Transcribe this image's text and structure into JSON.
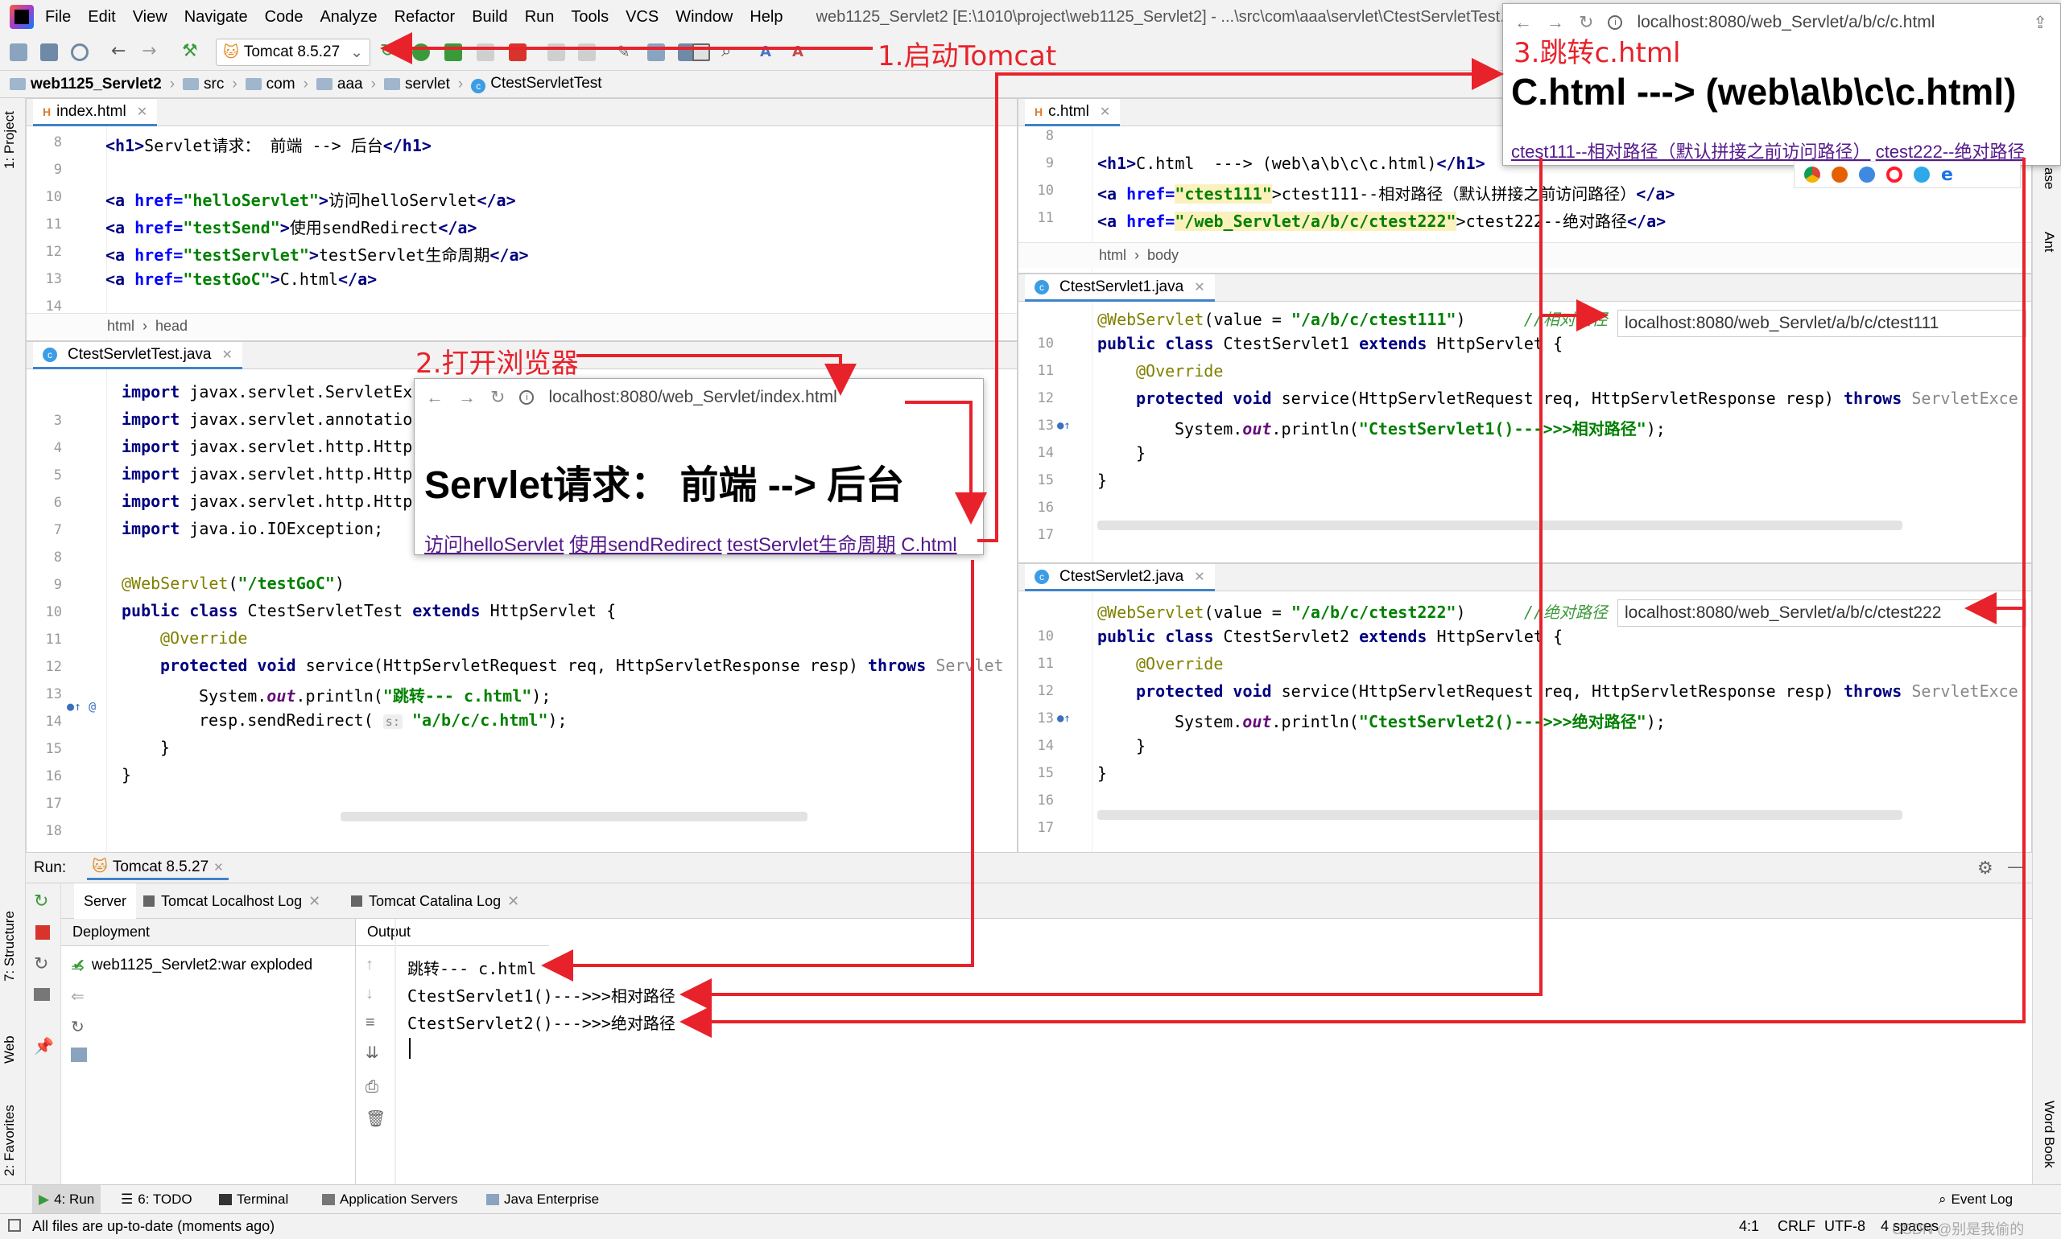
{
  "window": {
    "title": "web1125_Servlet2 [E:\\1010\\project\\web1125_Servlet2] - ...\\src\\com\\aaa\\servlet\\CtestServletTest.java - Int"
  },
  "menu": [
    "File",
    "Edit",
    "View",
    "Navigate",
    "Code",
    "Analyze",
    "Refactor",
    "Build",
    "Run",
    "Tools",
    "VCS",
    "Window",
    "Help"
  ],
  "toolbar": {
    "run_config": "Tomcat 8.5.27"
  },
  "breadcrumb": [
    "web1125_Servlet2",
    "src",
    "com",
    "aaa",
    "servlet",
    "CtestServletTest"
  ],
  "side_tabs": {
    "left": [
      "1: Project",
      "7: Structure",
      "Web",
      "2: Favorites"
    ],
    "right": [
      "ase",
      "Ant",
      "Word Book"
    ]
  },
  "editor_index": {
    "tab": "index.html",
    "lines": [
      {
        "n": "8"
      },
      {
        "n": "9"
      },
      {
        "n": "10"
      },
      {
        "n": "11"
      },
      {
        "n": "12"
      },
      {
        "n": "13"
      },
      {
        "n": "14"
      }
    ],
    "code": [
      {
        "h1_open": "<h1>",
        "text": "Servlet请求： 前端 --> 后台",
        "h1_close": "</h1>"
      },
      {
        "a_open": "<a ",
        "href": "href=",
        "val": "\"helloServlet\"",
        "gt": ">",
        "text": "访问helloServlet",
        "close": "</a>"
      },
      {
        "a_open": "<a ",
        "href": "href=",
        "val": "\"testSend\"",
        "gt": ">",
        "text": "使用sendRedirect",
        "close": "</a>"
      },
      {
        "a_open": "<a ",
        "href": "href=",
        "val": "\"testServlet\"",
        "gt": ">",
        "text": "testServlet生命周期",
        "close": "</a>"
      },
      {
        "a_open": "<a ",
        "href": "href=",
        "val": "\"testGoC\"",
        "gt": ">",
        "text": "C.html",
        "close": "</a>"
      }
    ],
    "crumbs": [
      "html",
      "head"
    ]
  },
  "editor_test": {
    "tab": "CtestServletTest.java",
    "line_numbers": [
      "3",
      "4",
      "5",
      "6",
      "7",
      "8",
      "9",
      "10",
      "11",
      "12",
      "13",
      "14",
      "15",
      "16",
      "17",
      "18"
    ],
    "imports": [
      "javax.servlet.ServletEx",
      "javax.servlet.annotatio",
      "javax.servlet.http.Http",
      "javax.servlet.http.Http",
      "javax.servlet.http.Http",
      "java.io.IOException;"
    ],
    "import_kw": "import",
    "annotation": "@WebServlet",
    "annotation_arg": "\"/testGoC\"",
    "class_decl": {
      "kw1": "public class",
      "name": "CtestServletTest",
      "kw2": "extends",
      "parent": "HttpServlet {"
    },
    "override": "@Override",
    "method": {
      "kw": "protected void",
      "sig": "service(HttpServletRequest req, HttpServletResponse resp)",
      "throws": "throws",
      "rest": "Servlet"
    },
    "println": {
      "pre": "System.",
      "out": "out",
      "mid": ".println(",
      "str": "\"跳转--- c.html\"",
      "end": ");"
    },
    "redirect": {
      "pre": "resp.sendRedirect(",
      "hint": "s:",
      "str": "\"a/b/c/c.html\"",
      "end": ");"
    },
    "close1": "}",
    "close2": "}"
  },
  "editor_c": {
    "tab": "c.html",
    "line_numbers": [
      "8",
      "9",
      "10",
      "11"
    ],
    "l9": {
      "open": "<h1>",
      "text": "C.html  ---> (web\\a\\b\\c\\c.html)",
      "close": "</h1>"
    },
    "l10": {
      "a": "<a ",
      "href": "href=",
      "val": "\"ctest111\"",
      "text": ">ctest111--相对路径（默认拼接之前访问路径）",
      "close": "</a>"
    },
    "l11": {
      "a": "<a ",
      "href": "href=",
      "val": "\"/web_Servlet/a/b/c/ctest222\"",
      "text": ">ctest222--绝对路径",
      "close": "</a>"
    },
    "crumbs": [
      "html",
      "body"
    ]
  },
  "editor_s1": {
    "tab": "CtestServlet1.java",
    "line_numbers": [
      "10",
      "11",
      "12",
      "13",
      "14",
      "15",
      "16",
      "17"
    ],
    "anno": "@WebServlet",
    "anno_args": "(value = ",
    "anno_str": "\"/a/b/c/ctest111\"",
    "anno_end": ")",
    "comment": "//相对路径",
    "decl": {
      "kw1": "public class",
      "name": "CtestServlet1",
      "kw2": "extends",
      "parent": "HttpServlet {"
    },
    "override": "@Override",
    "method": {
      "kw": "protected void",
      "sig": "service(HttpServletRequest req, HttpServletResponse resp)",
      "throws": "throws",
      "rest": "ServletExce"
    },
    "println": {
      "pre": "System.",
      "out": "out",
      "mid": ".println(",
      "str": "\"CtestServlet1()--->>>相对路径\"",
      "end": ");"
    },
    "close1": "}",
    "close2": "}",
    "tip": "localhost:8080/web_Servlet/a/b/c/ctest111"
  },
  "editor_s2": {
    "tab": "CtestServlet2.java",
    "line_numbers": [
      "10",
      "11",
      "12",
      "13",
      "14",
      "15",
      "16",
      "17"
    ],
    "anno": "@WebServlet",
    "anno_args": "(value = ",
    "anno_str": "\"/a/b/c/ctest222\"",
    "anno_end": ")",
    "comment": "//绝对路径",
    "decl": {
      "kw1": "public class",
      "name": "CtestServlet2",
      "kw2": "extends",
      "parent": "HttpServlet {"
    },
    "override": "@Override",
    "method": {
      "kw": "protected void",
      "sig": "service(HttpServletRequest req, HttpServletResponse resp)",
      "throws": "throws",
      "rest": "ServletExce"
    },
    "println": {
      "pre": "System.",
      "out": "out",
      "mid": ".println(",
      "str": "\"CtestServlet2()--->>>绝对路径\"",
      "end": ");"
    },
    "close1": "}",
    "close2": "}",
    "tip": "localhost:8080/web_Servlet/a/b/c/ctest222"
  },
  "browser1": {
    "url": "localhost:8080/web_Servlet/index.html",
    "heading": "Servlet请求： 前端 --> 后台",
    "links": [
      "访问helloServlet",
      "使用sendRedirect",
      "testServlet生命周期",
      "C.html"
    ]
  },
  "browser2": {
    "url": "localhost:8080/web_Servlet/a/b/c/c.html",
    "heading": "C.html ---> (web\\a\\b\\c\\c.html)",
    "links": [
      "ctest111--相对路径（默认拼接之前访问路径）",
      "ctest222--绝对路径"
    ]
  },
  "annotations": {
    "n1": "1.启动Tomcat",
    "n2": "2.打开浏览器",
    "n3": "3.跳转c.html"
  },
  "run": {
    "label": "Run:",
    "config": "Tomcat 8.5.27",
    "tabs": [
      "Server",
      "Tomcat Localhost Log",
      "Tomcat Catalina Log"
    ],
    "deployment_header": "Deployment",
    "output_header": "Output",
    "artifact": "web1125_Servlet2:war exploded",
    "output": [
      "跳转--- c.html",
      "CtestServlet1()--->>>相对路径",
      "CtestServlet2()--->>>绝对路径"
    ]
  },
  "tool_windows": [
    "4: Run",
    "6: TODO",
    "Terminal",
    "Application Servers",
    "Java Enterprise",
    "Event Log"
  ],
  "status": {
    "message": "All files are up-to-date (moments ago)",
    "position": "4:1",
    "line_sep": "CRLF",
    "encoding": "UTF-8",
    "indent": "4 spaces",
    "watermark": "CSDN @别是我偷的"
  },
  "colors": {
    "accent": "#e8222b",
    "link": "#551a8b",
    "keyword": "#000080",
    "string": "#008000"
  }
}
